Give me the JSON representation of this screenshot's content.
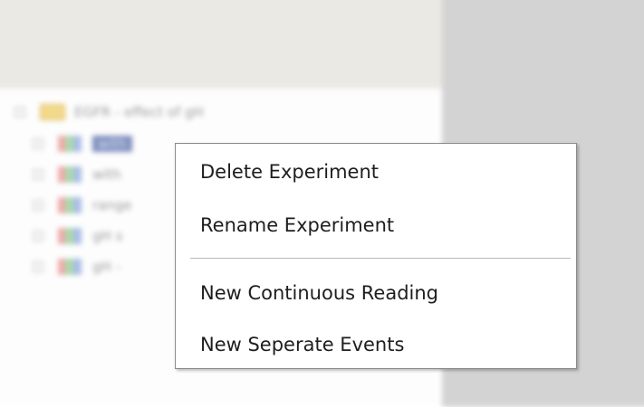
{
  "context_menu": {
    "items": [
      {
        "label": "Delete Experiment"
      },
      {
        "label": "Rename Experiment"
      },
      {
        "label": "New Continuous Reading"
      },
      {
        "label": "New Seperate Events"
      }
    ]
  },
  "tree": {
    "folder_label": "EGFR - effect of gH",
    "experiments": [
      {
        "label": "with"
      },
      {
        "label": "with"
      },
      {
        "label": "range"
      },
      {
        "label": "gH s"
      },
      {
        "label": "gH -"
      }
    ]
  },
  "colors": {
    "toolbar": "#ebe9e3",
    "side_panel": "#d3d3d3",
    "selection": "#7e8fbf",
    "menu_border": "#8a8a8a"
  }
}
